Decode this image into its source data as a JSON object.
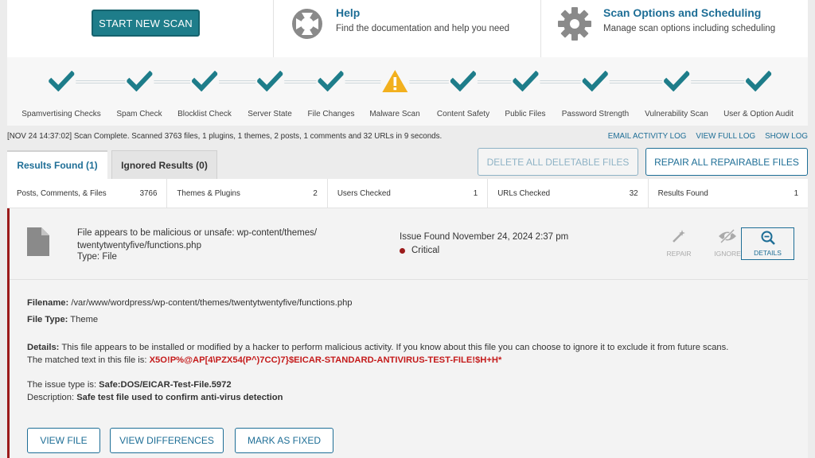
{
  "colors": {
    "accent": "#1e7d8a",
    "link": "#1e6e96",
    "success": "#1e7d8a",
    "warning": "#f2b01e",
    "critical": "#9b1b1b",
    "matched": "#c41a1a"
  },
  "header": {
    "start_scan": "START NEW SCAN",
    "help": {
      "icon": "lifebuoy-icon",
      "title": "Help",
      "desc": "Find the documentation and help you need"
    },
    "options": {
      "icon": "gear-icon",
      "title": "Scan Options and Scheduling",
      "desc": "Manage scan options including scheduling"
    }
  },
  "steps": [
    {
      "label": "Spamvertising Checks",
      "status": "ok"
    },
    {
      "label": "Spam Check",
      "status": "ok"
    },
    {
      "label": "Blocklist Check",
      "status": "ok"
    },
    {
      "label": "Server State",
      "status": "ok"
    },
    {
      "label": "File Changes",
      "status": "ok"
    },
    {
      "label": "Malware Scan",
      "status": "warning"
    },
    {
      "label": "Content Safety",
      "status": "ok"
    },
    {
      "label": "Public Files",
      "status": "ok"
    },
    {
      "label": "Password Strength",
      "status": "ok"
    },
    {
      "label": "Vulnerability Scan",
      "status": "ok"
    },
    {
      "label": "User & Option Audit",
      "status": "ok"
    }
  ],
  "log": {
    "text": "[NOV 24 14:37:02] Scan Complete. Scanned 3763 files, 1 plugins, 1 themes, 2 posts, 1 comments and 32 URLs in 9 seconds.",
    "email": "EMAIL ACTIVITY LOG",
    "full": "VIEW FULL LOG",
    "show": "SHOW LOG"
  },
  "tabs": {
    "results": "Results Found (1)",
    "ignored": "Ignored Results (0)"
  },
  "bulk": {
    "delete": "DELETE ALL DELETABLE FILES",
    "repair": "REPAIR ALL REPAIRABLE FILES"
  },
  "summary": [
    {
      "label": "Posts, Comments, & Files",
      "value": "3766"
    },
    {
      "label": "Themes & Plugins",
      "value": "2"
    },
    {
      "label": "Users Checked",
      "value": "1"
    },
    {
      "label": "URLs Checked",
      "value": "32"
    },
    {
      "label": "Results Found",
      "value": "1"
    }
  ],
  "issue": {
    "title": "File appears to be malicious or unsafe: wp-content/themes/ twentytwentyfive/functions.php",
    "type": "Type: File",
    "found": "Issue Found November 24, 2024 2:37 pm",
    "severity": "Critical",
    "actions": {
      "repair": "REPAIR",
      "ignore": "IGNORE",
      "details": "DETAILS"
    },
    "filename_label": "Filename:",
    "filename": "/var/www/wordpress/wp-content/themes/twentytwentyfive/functions.php",
    "filetype_label": "File Type:",
    "filetype": "Theme",
    "details_label": "Details:",
    "details": "This file appears to be installed or modified by a hacker to perform malicious activity. If you know about this file you can choose to ignore it to exclude it from future scans.",
    "matched_label": "The matched text in this file is:",
    "matched": "X5O!P%@AP[4\\PZX54(P^)7CC)7}$EICAR-STANDARD-ANTIVIRUS-TEST-FILE!$H+H*",
    "issue_type_label": "The issue type is:",
    "issue_type": "Safe:DOS/EICAR-Test-File.5972",
    "description_label": "Description:",
    "description": "Safe test file used to confirm anti-virus detection",
    "buttons": {
      "view": "VIEW FILE",
      "diff": "VIEW DIFFERENCES",
      "fixed": "MARK AS FIXED"
    }
  }
}
